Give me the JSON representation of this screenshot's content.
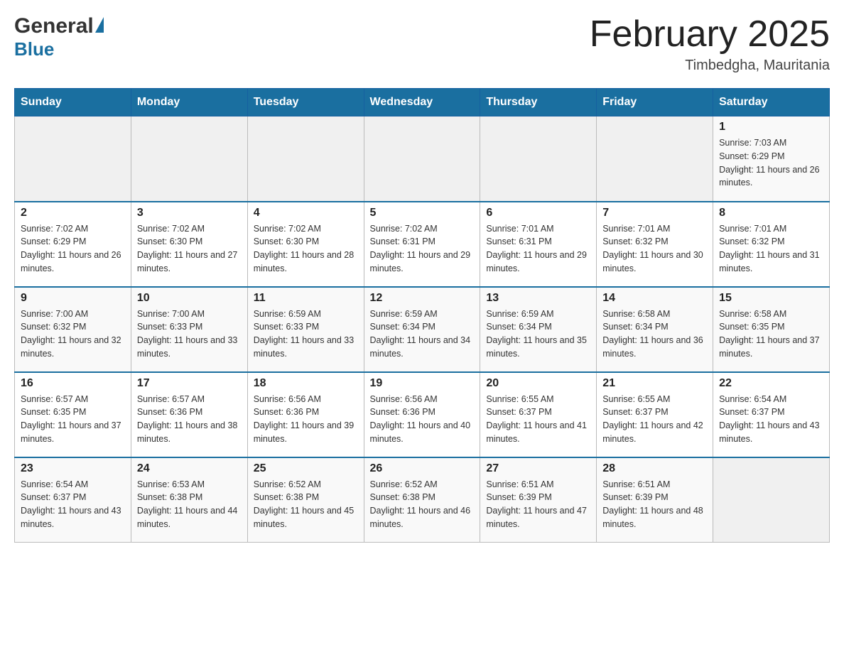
{
  "header": {
    "logo_general": "General",
    "logo_blue": "Blue",
    "month_title": "February 2025",
    "location": "Timbedgha, Mauritania"
  },
  "weekdays": [
    "Sunday",
    "Monday",
    "Tuesday",
    "Wednesday",
    "Thursday",
    "Friday",
    "Saturday"
  ],
  "weeks": [
    [
      {
        "day": "",
        "sunrise": "",
        "sunset": "",
        "daylight": ""
      },
      {
        "day": "",
        "sunrise": "",
        "sunset": "",
        "daylight": ""
      },
      {
        "day": "",
        "sunrise": "",
        "sunset": "",
        "daylight": ""
      },
      {
        "day": "",
        "sunrise": "",
        "sunset": "",
        "daylight": ""
      },
      {
        "day": "",
        "sunrise": "",
        "sunset": "",
        "daylight": ""
      },
      {
        "day": "",
        "sunrise": "",
        "sunset": "",
        "daylight": ""
      },
      {
        "day": "1",
        "sunrise": "Sunrise: 7:03 AM",
        "sunset": "Sunset: 6:29 PM",
        "daylight": "Daylight: 11 hours and 26 minutes."
      }
    ],
    [
      {
        "day": "2",
        "sunrise": "Sunrise: 7:02 AM",
        "sunset": "Sunset: 6:29 PM",
        "daylight": "Daylight: 11 hours and 26 minutes."
      },
      {
        "day": "3",
        "sunrise": "Sunrise: 7:02 AM",
        "sunset": "Sunset: 6:30 PM",
        "daylight": "Daylight: 11 hours and 27 minutes."
      },
      {
        "day": "4",
        "sunrise": "Sunrise: 7:02 AM",
        "sunset": "Sunset: 6:30 PM",
        "daylight": "Daylight: 11 hours and 28 minutes."
      },
      {
        "day": "5",
        "sunrise": "Sunrise: 7:02 AM",
        "sunset": "Sunset: 6:31 PM",
        "daylight": "Daylight: 11 hours and 29 minutes."
      },
      {
        "day": "6",
        "sunrise": "Sunrise: 7:01 AM",
        "sunset": "Sunset: 6:31 PM",
        "daylight": "Daylight: 11 hours and 29 minutes."
      },
      {
        "day": "7",
        "sunrise": "Sunrise: 7:01 AM",
        "sunset": "Sunset: 6:32 PM",
        "daylight": "Daylight: 11 hours and 30 minutes."
      },
      {
        "day": "8",
        "sunrise": "Sunrise: 7:01 AM",
        "sunset": "Sunset: 6:32 PM",
        "daylight": "Daylight: 11 hours and 31 minutes."
      }
    ],
    [
      {
        "day": "9",
        "sunrise": "Sunrise: 7:00 AM",
        "sunset": "Sunset: 6:32 PM",
        "daylight": "Daylight: 11 hours and 32 minutes."
      },
      {
        "day": "10",
        "sunrise": "Sunrise: 7:00 AM",
        "sunset": "Sunset: 6:33 PM",
        "daylight": "Daylight: 11 hours and 33 minutes."
      },
      {
        "day": "11",
        "sunrise": "Sunrise: 6:59 AM",
        "sunset": "Sunset: 6:33 PM",
        "daylight": "Daylight: 11 hours and 33 minutes."
      },
      {
        "day": "12",
        "sunrise": "Sunrise: 6:59 AM",
        "sunset": "Sunset: 6:34 PM",
        "daylight": "Daylight: 11 hours and 34 minutes."
      },
      {
        "day": "13",
        "sunrise": "Sunrise: 6:59 AM",
        "sunset": "Sunset: 6:34 PM",
        "daylight": "Daylight: 11 hours and 35 minutes."
      },
      {
        "day": "14",
        "sunrise": "Sunrise: 6:58 AM",
        "sunset": "Sunset: 6:34 PM",
        "daylight": "Daylight: 11 hours and 36 minutes."
      },
      {
        "day": "15",
        "sunrise": "Sunrise: 6:58 AM",
        "sunset": "Sunset: 6:35 PM",
        "daylight": "Daylight: 11 hours and 37 minutes."
      }
    ],
    [
      {
        "day": "16",
        "sunrise": "Sunrise: 6:57 AM",
        "sunset": "Sunset: 6:35 PM",
        "daylight": "Daylight: 11 hours and 37 minutes."
      },
      {
        "day": "17",
        "sunrise": "Sunrise: 6:57 AM",
        "sunset": "Sunset: 6:36 PM",
        "daylight": "Daylight: 11 hours and 38 minutes."
      },
      {
        "day": "18",
        "sunrise": "Sunrise: 6:56 AM",
        "sunset": "Sunset: 6:36 PM",
        "daylight": "Daylight: 11 hours and 39 minutes."
      },
      {
        "day": "19",
        "sunrise": "Sunrise: 6:56 AM",
        "sunset": "Sunset: 6:36 PM",
        "daylight": "Daylight: 11 hours and 40 minutes."
      },
      {
        "day": "20",
        "sunrise": "Sunrise: 6:55 AM",
        "sunset": "Sunset: 6:37 PM",
        "daylight": "Daylight: 11 hours and 41 minutes."
      },
      {
        "day": "21",
        "sunrise": "Sunrise: 6:55 AM",
        "sunset": "Sunset: 6:37 PM",
        "daylight": "Daylight: 11 hours and 42 minutes."
      },
      {
        "day": "22",
        "sunrise": "Sunrise: 6:54 AM",
        "sunset": "Sunset: 6:37 PM",
        "daylight": "Daylight: 11 hours and 43 minutes."
      }
    ],
    [
      {
        "day": "23",
        "sunrise": "Sunrise: 6:54 AM",
        "sunset": "Sunset: 6:37 PM",
        "daylight": "Daylight: 11 hours and 43 minutes."
      },
      {
        "day": "24",
        "sunrise": "Sunrise: 6:53 AM",
        "sunset": "Sunset: 6:38 PM",
        "daylight": "Daylight: 11 hours and 44 minutes."
      },
      {
        "day": "25",
        "sunrise": "Sunrise: 6:52 AM",
        "sunset": "Sunset: 6:38 PM",
        "daylight": "Daylight: 11 hours and 45 minutes."
      },
      {
        "day": "26",
        "sunrise": "Sunrise: 6:52 AM",
        "sunset": "Sunset: 6:38 PM",
        "daylight": "Daylight: 11 hours and 46 minutes."
      },
      {
        "day": "27",
        "sunrise": "Sunrise: 6:51 AM",
        "sunset": "Sunset: 6:39 PM",
        "daylight": "Daylight: 11 hours and 47 minutes."
      },
      {
        "day": "28",
        "sunrise": "Sunrise: 6:51 AM",
        "sunset": "Sunset: 6:39 PM",
        "daylight": "Daylight: 11 hours and 48 minutes."
      },
      {
        "day": "",
        "sunrise": "",
        "sunset": "",
        "daylight": ""
      }
    ]
  ]
}
